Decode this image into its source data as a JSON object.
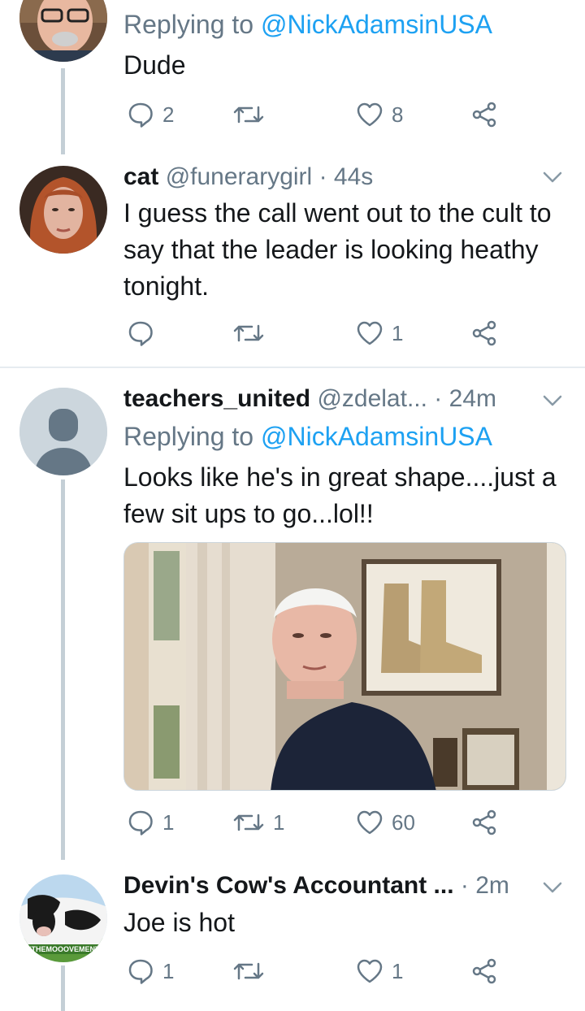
{
  "tweets": [
    {
      "reply_label": "Replying to",
      "reply_handle": "@NickAdamsinUSA",
      "text": "Dude",
      "actions": {
        "reply": "2",
        "retweet": "",
        "like": "8"
      }
    },
    {
      "name": "cat",
      "handle": "@funerarygirl",
      "dot": "·",
      "time": "44s",
      "text": "I guess the call went out to the cult to say that the leader is looking heathy tonight.",
      "actions": {
        "reply": "",
        "retweet": "",
        "like": "1"
      }
    },
    {
      "name": "teachers_united",
      "handle": "@zdelat...",
      "dot": "·",
      "time": "24m",
      "reply_label": "Replying to",
      "reply_handle": "@NickAdamsinUSA",
      "text": "Looks like he's in great shape....just a few sit ups to go...lol!!",
      "actions": {
        "reply": "1",
        "retweet": "1",
        "like": "60"
      }
    },
    {
      "name": "Devin's Cow's Accountant ...",
      "dot": "·",
      "time": "2m",
      "text": "Joe is hot",
      "avatar_caption": "#THEMOOOVEMENT",
      "actions": {
        "reply": "1",
        "retweet": "",
        "like": "1"
      }
    }
  ],
  "icons": {
    "reply": "reply-icon",
    "retweet": "retweet-icon",
    "like": "heart-icon",
    "share": "share-icon",
    "caret": "chevron-down-icon"
  },
  "colors": {
    "link": "#1da1f2",
    "secondary_text": "#657786",
    "thread_line": "#c4cfd6",
    "divider": "#e6ecf0"
  }
}
